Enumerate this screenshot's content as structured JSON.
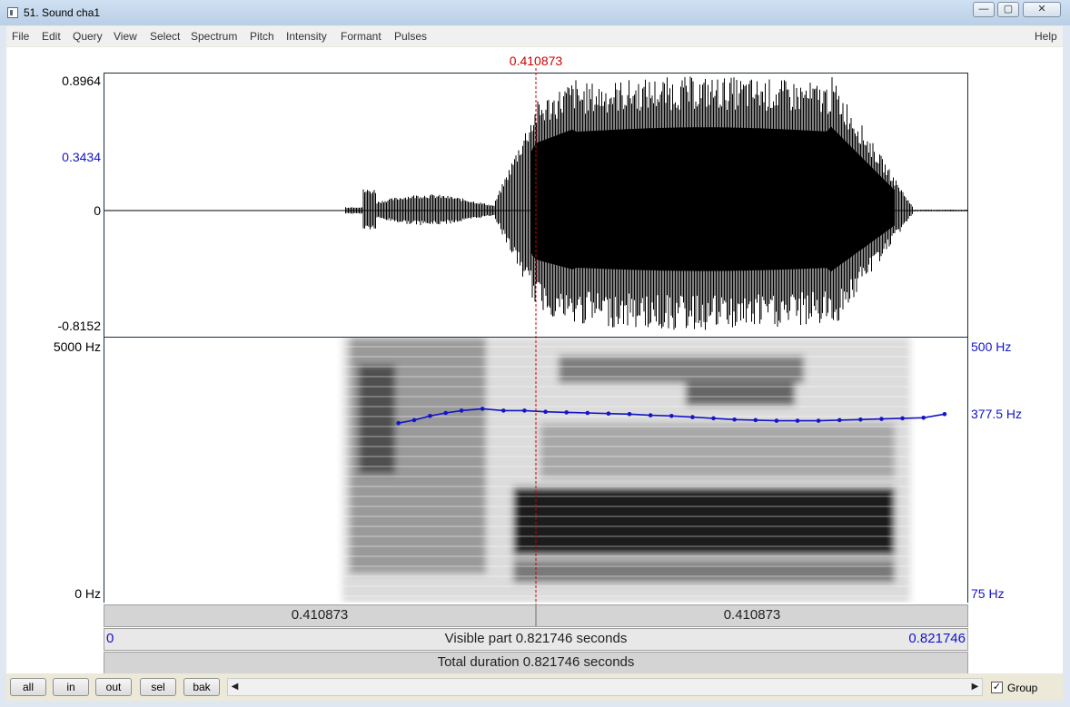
{
  "window": {
    "title": "51. Sound cha1",
    "min_glyph": "—",
    "max_glyph": "▢",
    "close_glyph": "✕"
  },
  "menu": [
    "File",
    "Edit",
    "Query",
    "View",
    "Select",
    "Spectrum",
    "Pitch",
    "Intensity",
    "Formant",
    "Pulses"
  ],
  "help_label": "Help",
  "cursor": {
    "time_label": "0.410873"
  },
  "waveform": {
    "ymax_label": "0.8964",
    "cursor_value_label": "0.3434",
    "zero_label": "0",
    "ymin_label": "-0.8152"
  },
  "spectrogram": {
    "fmax_label": "5000 Hz",
    "fmin_label": "0 Hz"
  },
  "pitch": {
    "top_label": "500 Hz",
    "cursor_label": "377.5 Hz",
    "bottom_label": "75 Hz",
    "range_hz": [
      75,
      500
    ],
    "color": "#1414c8",
    "track": [
      [
        0.28,
        357
      ],
      [
        0.295,
        362
      ],
      [
        0.31,
        369
      ],
      [
        0.325,
        374
      ],
      [
        0.34,
        378
      ],
      [
        0.36,
        381
      ],
      [
        0.38,
        378
      ],
      [
        0.4,
        378
      ],
      [
        0.42,
        376
      ],
      [
        0.44,
        375
      ],
      [
        0.46,
        374
      ],
      [
        0.48,
        373
      ],
      [
        0.5,
        372
      ],
      [
        0.52,
        370
      ],
      [
        0.54,
        369
      ],
      [
        0.56,
        367
      ],
      [
        0.58,
        365
      ],
      [
        0.6,
        363
      ],
      [
        0.62,
        362
      ],
      [
        0.64,
        361
      ],
      [
        0.66,
        361
      ],
      [
        0.68,
        361
      ],
      [
        0.7,
        362
      ],
      [
        0.72,
        363
      ],
      [
        0.74,
        364
      ],
      [
        0.76,
        365
      ],
      [
        0.78,
        366
      ],
      [
        0.8,
        372
      ]
    ]
  },
  "time_bars": {
    "selection_left": "0.410873",
    "selection_right": "0.410873",
    "visible_start": "0",
    "visible_text": "Visible part 0.821746 seconds",
    "visible_end": "0.821746",
    "total_text": "Total duration 0.821746 seconds"
  },
  "buttons": [
    "all",
    "in",
    "out",
    "sel",
    "bak"
  ],
  "group": {
    "label": "Group",
    "checked": true,
    "check_glyph": "✓"
  },
  "scroll": {
    "left_arrow": "◀",
    "right_arrow": "▶"
  },
  "colors": {
    "cursor": "#d00000",
    "axis_label_blue": "#1414c8"
  }
}
